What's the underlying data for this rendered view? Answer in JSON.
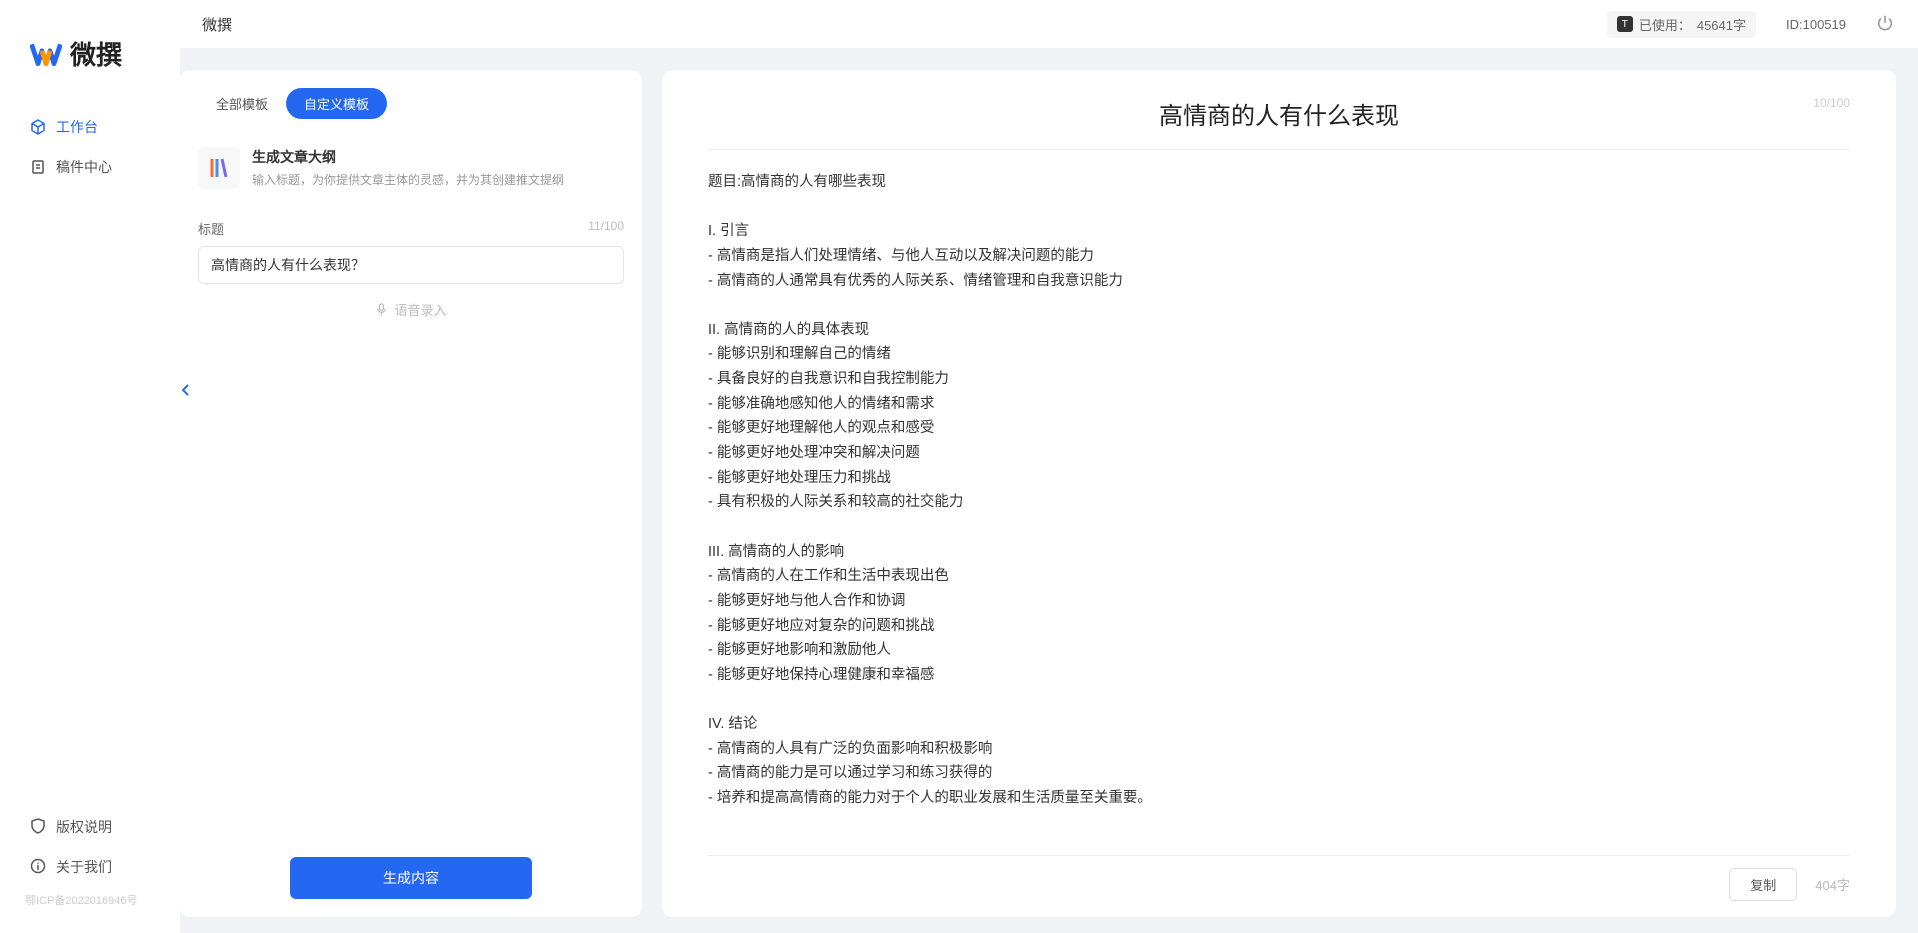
{
  "app": {
    "name": "微撰",
    "topTitle": "微撰"
  },
  "topbar": {
    "usage_prefix": "已使用：",
    "usage_value": "45641字",
    "id_label": "ID:100519"
  },
  "sidebar": {
    "nav": [
      {
        "label": "工作台",
        "icon": "cube"
      },
      {
        "label": "稿件中心",
        "icon": "doc"
      }
    ],
    "footer": [
      {
        "label": "版权说明",
        "icon": "shield"
      },
      {
        "label": "关于我们",
        "icon": "info"
      }
    ],
    "icp": "鄂ICP备2022016946号"
  },
  "leftPanel": {
    "tabs": {
      "all": "全部模板",
      "custom": "自定义模板"
    },
    "template": {
      "title": "生成文章大纲",
      "desc": "输入标题，为你提供文章主体的灵感，并为其创建推文提纲"
    },
    "form": {
      "label": "标题",
      "count": "11/100",
      "value": "高情商的人有什么表现？",
      "voice_hint": "语音录入"
    },
    "generate": "生成内容"
  },
  "output": {
    "title": "高情商的人有什么表现",
    "title_count": "10/100",
    "body": "题目:高情商的人有哪些表现\n\nI. 引言\n- 高情商是指人们处理情绪、与他人互动以及解决问题的能力\n- 高情商的人通常具有优秀的人际关系、情绪管理和自我意识能力\n\nII. 高情商的人的具体表现\n- 能够识别和理解自己的情绪\n- 具备良好的自我意识和自我控制能力\n- 能够准确地感知他人的情绪和需求\n- 能够更好地理解他人的观点和感受\n- 能够更好地处理冲突和解决问题\n- 能够更好地处理压力和挑战\n- 具有积极的人际关系和较高的社交能力\n\nIII. 高情商的人的影响\n- 高情商的人在工作和生活中表现出色\n- 能够更好地与他人合作和协调\n- 能够更好地应对复杂的问题和挑战\n- 能够更好地影响和激励他人\n- 能够更好地保持心理健康和幸福感\n\nIV. 结论\n- 高情商的人具有广泛的负面影响和积极影响\n- 高情商的能力是可以通过学习和练习获得的\n- 培养和提高高情商的能力对于个人的职业发展和生活质量至关重要。",
    "copy": "复制",
    "word_count": "404字"
  }
}
